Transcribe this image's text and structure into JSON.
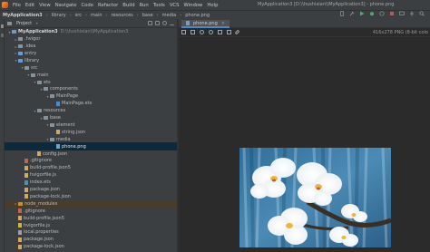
{
  "menubar": {
    "items": [
      "File",
      "Edit",
      "View",
      "Navigate",
      "Code",
      "Refactor",
      "Build",
      "Run",
      "Tools",
      "VCS",
      "Window",
      "Help"
    ],
    "window_title": "MyApplication3 [D:\\\\hushixian\\\\MyApplication3] - phone.png"
  },
  "navbar": {
    "crumbs": [
      "MyApplication3",
      "library",
      "src",
      "main",
      "resources",
      "base",
      "media",
      "phone.png"
    ]
  },
  "project_panel": {
    "title": "Project",
    "tree": [
      {
        "label": "MyApplication3",
        "suffix": "D:\\\\hushixian\\\\MyApplication3",
        "depth": 0,
        "icon": "folder-blue",
        "arrow": "down",
        "bold": true
      },
      {
        "label": ".hvigor",
        "depth": 1,
        "icon": "folder",
        "arrow": "right"
      },
      {
        "label": ".idea",
        "depth": 1,
        "icon": "folder",
        "arrow": "right"
      },
      {
        "label": "entry",
        "depth": 1,
        "icon": "folder-blue",
        "arrow": "right"
      },
      {
        "label": "library",
        "depth": 1,
        "icon": "folder-blue",
        "arrow": "down"
      },
      {
        "label": "src",
        "depth": 2,
        "icon": "folder",
        "arrow": "down"
      },
      {
        "label": "main",
        "depth": 3,
        "icon": "folder",
        "arrow": "down"
      },
      {
        "label": "ets",
        "depth": 4,
        "icon": "folder",
        "arrow": "down"
      },
      {
        "label": "components",
        "depth": 5,
        "icon": "folder",
        "arrow": "down"
      },
      {
        "label": "MainPage",
        "depth": 6,
        "icon": "folder",
        "arrow": "down"
      },
      {
        "label": "MainPage.ets",
        "depth": 7,
        "icon": "file-ts",
        "arrow": ""
      },
      {
        "label": "resources",
        "depth": 4,
        "icon": "folder",
        "arrow": "down"
      },
      {
        "label": "base",
        "depth": 5,
        "icon": "folder",
        "arrow": "down"
      },
      {
        "label": "element",
        "depth": 6,
        "icon": "folder",
        "arrow": "down"
      },
      {
        "label": "string.json",
        "depth": 7,
        "icon": "file-json",
        "arrow": ""
      },
      {
        "label": "media",
        "depth": 6,
        "icon": "folder",
        "arrow": "down"
      },
      {
        "label": "phone.png",
        "depth": 7,
        "icon": "file-img",
        "arrow": "",
        "selected": true
      },
      {
        "label": "config.json",
        "depth": 4,
        "icon": "file-json",
        "arrow": ""
      },
      {
        "label": ".gitignore",
        "depth": 2,
        "icon": "file-git",
        "arrow": ""
      },
      {
        "label": "build-profile.json5",
        "depth": 2,
        "icon": "file-json",
        "arrow": ""
      },
      {
        "label": "hvigorfile.js",
        "depth": 2,
        "icon": "file-js",
        "arrow": ""
      },
      {
        "label": "index.ets",
        "depth": 2,
        "icon": "file-ts",
        "arrow": ""
      },
      {
        "label": "package.json",
        "depth": 2,
        "icon": "file-json",
        "arrow": ""
      },
      {
        "label": "package-lock.json",
        "depth": 2,
        "icon": "file-json",
        "arrow": ""
      },
      {
        "label": "node_modules",
        "depth": 1,
        "icon": "folder-orange",
        "arrow": "right",
        "highlight": true
      },
      {
        "label": ".gitignore",
        "depth": 1,
        "icon": "file-git",
        "arrow": ""
      },
      {
        "label": "build-profile.json5",
        "depth": 1,
        "icon": "file-json",
        "arrow": ""
      },
      {
        "label": "hvigorfile.js",
        "depth": 1,
        "icon": "file-js",
        "arrow": ""
      },
      {
        "label": "local.properties",
        "depth": 1,
        "icon": "file-prop",
        "arrow": ""
      },
      {
        "label": "package.json",
        "depth": 1,
        "icon": "file-json",
        "arrow": ""
      },
      {
        "label": "package-lock.json",
        "depth": 1,
        "icon": "file-json",
        "arrow": ""
      }
    ]
  },
  "editor": {
    "tab_label": "phone.png",
    "image_info": "416x278 PNG (8-bit colo"
  },
  "colors": {
    "accent": "#4a88c7",
    "selection": "#0d293e",
    "panel": "#3c3f41",
    "editor_bg": "#2b2b2b"
  }
}
